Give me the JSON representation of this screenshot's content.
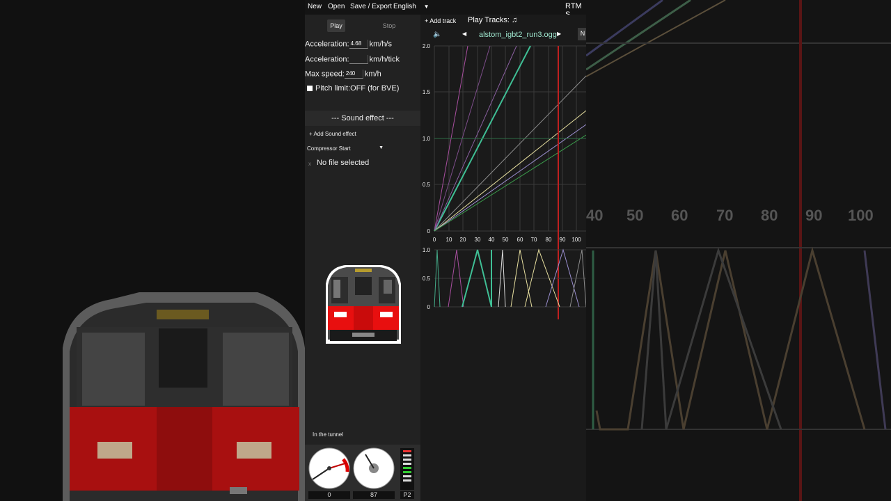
{
  "menu": {
    "new": "New",
    "open": "Open",
    "save_export": "Save / Export",
    "language": "English",
    "app_title": "RTM S"
  },
  "controls": {
    "play": "Play",
    "stop": "Stop",
    "acceleration_label": "Acceleration:",
    "acceleration_value": "4.68",
    "acceleration_unit": "km/h/s",
    "acceleration_tick_label": "Acceleration:",
    "acceleration_tick_value": "",
    "acceleration_tick_unit": "km/h/tick",
    "max_speed_label": "Max speed:",
    "max_speed_value": "240",
    "max_speed_unit": "km/h",
    "pitch_limit_label": "Pitch limit:OFF (for BVE)"
  },
  "sound_effect": {
    "header": "---    Sound effect    ---",
    "add_label": "+ Add Sound effect",
    "selected": "Compressor Start",
    "remove": "x",
    "file_status": "No file selected"
  },
  "status": {
    "location": "In the tunnel"
  },
  "gauges": {
    "left_value": "0",
    "right_value": "87",
    "notch": "P2"
  },
  "tracks": {
    "add_track": "+ Add track",
    "play_tracks": "Play Tracks:",
    "current_file": "alstom_igbt2_run3.ogg",
    "extra_button": "N"
  },
  "graph": {
    "y_labels": [
      "2.0",
      "1.5",
      "1.0",
      "0.5",
      "0"
    ],
    "x_labels": [
      "0",
      "10",
      "20",
      "30",
      "40",
      "50",
      "60",
      "70",
      "80",
      "90",
      "100"
    ],
    "lower_y_labels": [
      "1.0",
      "0.5",
      "0"
    ]
  },
  "background_ticks": [
    "40",
    "50",
    "60",
    "70",
    "80",
    "90",
    "100"
  ],
  "colors": {
    "accent_train": "#e00000",
    "marker": "#c02020",
    "track_text": "#9fe7cf"
  }
}
